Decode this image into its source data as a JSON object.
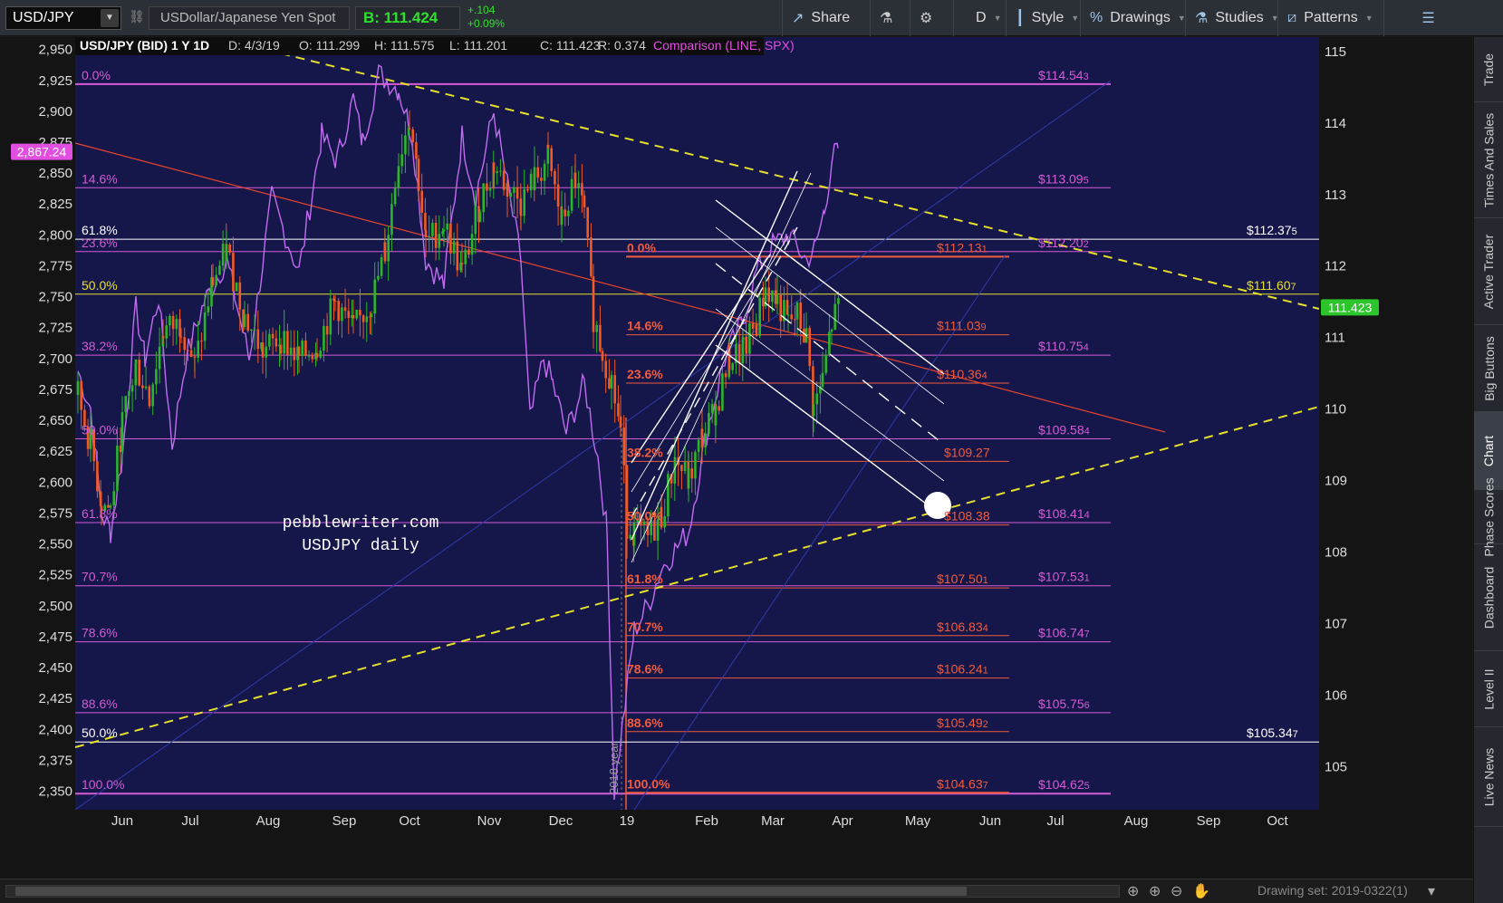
{
  "toolbar": {
    "symbol": "USD/JPY",
    "description": "USDollar/Japanese Yen Spot",
    "bid": "B: 111.424",
    "change_abs": "+.104",
    "change_pct": "+0.09%",
    "share_label": "Share",
    "period_label": "D",
    "style_label": "Style",
    "drawings_label": "Drawings",
    "studies_label": "Studies",
    "patterns_label": "Patterns"
  },
  "chart": {
    "header": {
      "title": "USD/JPY (BID) 1 Y 1D",
      "date": "D: 4/3/19",
      "open": "O: 111.299",
      "high": "H: 111.575",
      "low": "L: 111.201",
      "close": "C: 111.423",
      "range": "R: 0.374",
      "comparison": "Comparison (LINE, SPX)"
    },
    "watermark": [
      "pebblewriter.com",
      "USDJPY daily"
    ],
    "year_marker": "2018 year",
    "left_axis_badge": "2,867.24",
    "price_badge": "111.423",
    "colors": {
      "background": "#15164a",
      "spx_line": "#c06cf0",
      "up_candle": "#2bb52b",
      "down_candle": "#f05a23",
      "magenta_fib": "#d55bd5",
      "red_fib": "#f25b3b",
      "yellow_trend": "#e6e02a",
      "badge_green": "#2cc52c",
      "badge_magenta": "#e14fe0"
    }
  },
  "chart_data": {
    "type": "candlestick",
    "right_axis": {
      "label": "USD/JPY price",
      "range": [
        104.4,
        115.2
      ],
      "ticks": [
        105,
        106,
        107,
        108,
        109,
        110,
        111,
        112,
        113,
        114,
        115
      ]
    },
    "left_axis": {
      "label": "SPX comparison",
      "range": [
        2335,
        2960
      ],
      "ticks": [
        "2,350",
        "2,375",
        "2,400",
        "2,425",
        "2,450",
        "2,475",
        "2,500",
        "2,525",
        "2,550",
        "2,575",
        "2,600",
        "2,625",
        "2,650",
        "2,675",
        "2,700",
        "2,725",
        "2,750",
        "2,775",
        "2,800",
        "2,825",
        "2,850",
        "2,875",
        "2,900",
        "2,925",
        "2,950"
      ]
    },
    "x_axis_labels": [
      "Jun",
      "Jul",
      "Aug",
      "Sep",
      "Oct",
      "Nov",
      "Dec",
      "19",
      "Feb",
      "Mar",
      "Apr",
      "May",
      "Jun",
      "Jul",
      "Aug",
      "Sep",
      "Oct"
    ],
    "fib_long": [
      {
        "pct": "0.0%",
        "price": 114.543,
        "label": "$114.54",
        "sub": "3"
      },
      {
        "pct": "14.6%",
        "price": 113.095,
        "label": "$113.09",
        "sub": "5"
      },
      {
        "pct": "23.6%",
        "price": 112.202,
        "label": "$112.20",
        "sub": "2"
      },
      {
        "pct": "38.2%",
        "price": 110.754,
        "label": "$110.75",
        "sub": "4"
      },
      {
        "pct": "50.0%",
        "price": 109.584,
        "label": "$109.58",
        "sub": "4"
      },
      {
        "pct": "61.8%",
        "price": 108.414,
        "label": "$108.41",
        "sub": "4"
      },
      {
        "pct": "70.7%",
        "price": 107.531,
        "label": "$107.53",
        "sub": "1"
      },
      {
        "pct": "78.6%",
        "price": 106.747,
        "label": "$106.74",
        "sub": "7"
      },
      {
        "pct": "88.6%",
        "price": 105.756,
        "label": "$105.75",
        "sub": "6"
      },
      {
        "pct": "100.0%",
        "price": 104.625,
        "label": "$104.62",
        "sub": "5"
      }
    ],
    "fib_short": [
      {
        "pct": "0.0%",
        "price": 112.131,
        "label": "$112.13",
        "sub": "1"
      },
      {
        "pct": "14.6%",
        "price": 111.039,
        "label": "$111.03",
        "sub": "9"
      },
      {
        "pct": "23.6%",
        "price": 110.364,
        "label": "$110.36",
        "sub": "4"
      },
      {
        "pct": "38.2%",
        "price": 109.27,
        "label": "$109.27",
        "sub": ""
      },
      {
        "pct": "50.0%",
        "price": 108.38,
        "label": "$108.38",
        "sub": ""
      },
      {
        "pct": "61.8%",
        "price": 107.501,
        "label": "$107.50",
        "sub": "1"
      },
      {
        "pct": "70.7%",
        "price": 106.834,
        "label": "$106.83",
        "sub": "4"
      },
      {
        "pct": "78.6%",
        "price": 106.241,
        "label": "$106.24",
        "sub": "1"
      },
      {
        "pct": "88.6%",
        "price": 105.492,
        "label": "$105.49",
        "sub": "2"
      },
      {
        "pct": "100.0%",
        "price": 104.637,
        "label": "$104.63",
        "sub": "7"
      }
    ],
    "white_levels": [
      {
        "pct": "61.8%",
        "price": 112.375,
        "label": "$112.37",
        "sub": "5"
      },
      {
        "pct": "50.0%",
        "price": 105.347,
        "label": "$105.34",
        "sub": "7"
      }
    ],
    "yellow_level": {
      "pct": "50.0%",
      "price": 111.607,
      "label": "$111.60",
      "sub": "7"
    }
  },
  "rail": {
    "tabs": [
      "Trade",
      "Times And Sales",
      "Active Trader",
      "Big Buttons",
      "Chart",
      "Phase Scores",
      "Dashboard",
      "Level II",
      "Live News"
    ]
  },
  "bottom": {
    "drawing_set": "Drawing set: 2019-0322(1)"
  }
}
